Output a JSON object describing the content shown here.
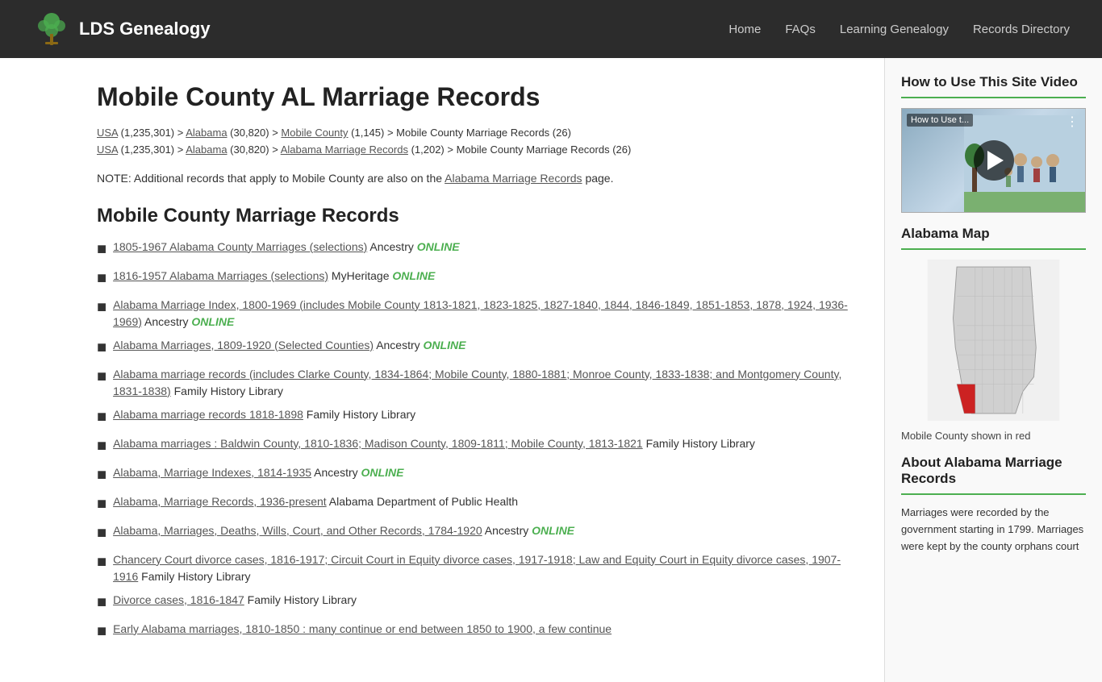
{
  "header": {
    "logo_text": "LDS Genealogy",
    "nav": [
      {
        "label": "Home",
        "id": "home"
      },
      {
        "label": "FAQs",
        "id": "faqs"
      },
      {
        "label": "Learning Genealogy",
        "id": "learning"
      },
      {
        "label": "Records Directory",
        "id": "records"
      }
    ]
  },
  "page": {
    "title": "Mobile County AL Marriage Records",
    "breadcrumbs": [
      {
        "line1_parts": [
          {
            "text": "USA",
            "link": true
          },
          {
            "text": " (1,235,301) > ",
            "link": false
          },
          {
            "text": "Alabama",
            "link": true
          },
          {
            "text": " (30,820) > ",
            "link": false
          },
          {
            "text": "Mobile County",
            "link": true
          },
          {
            "text": " (1,145) > Mobile County Marriage Records (26)",
            "link": false
          }
        ]
      },
      {
        "line2_parts": [
          {
            "text": "USA",
            "link": true
          },
          {
            "text": " (1,235,301) > ",
            "link": false
          },
          {
            "text": "Alabama",
            "link": true
          },
          {
            "text": " (30,820) > ",
            "link": false
          },
          {
            "text": "Alabama Marriage Records",
            "link": true
          },
          {
            "text": " (1,202) > Mobile County Marriage Records (26)",
            "link": false
          }
        ]
      }
    ],
    "note": "NOTE: Additional records that apply to Mobile County are also on the",
    "note_link": "Alabama Marriage Records",
    "note_end": " page.",
    "section_title": "Mobile County Marriage Records",
    "records": [
      {
        "link_text": "1805-1967 Alabama County Marriages (selections)",
        "source": " Ancestry ",
        "online": true
      },
      {
        "link_text": "1816-1957 Alabama Marriages (selections)",
        "source": " MyHeritage ",
        "online": true
      },
      {
        "link_text": "Alabama Marriage Index, 1800-1969 (includes Mobile County 1813-1821, 1823-1825, 1827-1840, 1844, 1846-1849, 1851-1853, 1878, 1924, 1936-1969)",
        "source": " Ancestry ",
        "online": true
      },
      {
        "link_text": "Alabama Marriages, 1809-1920 (Selected Counties)",
        "source": " Ancestry ",
        "online": true
      },
      {
        "link_text": "Alabama marriage records (includes Clarke County, 1834-1864; Mobile County, 1880-1881; Monroe County, 1833-1838; and Montgomery County, 1831-1838)",
        "source": " Family History Library",
        "online": false
      },
      {
        "link_text": "Alabama marriage records 1818-1898",
        "source": " Family History Library",
        "online": false
      },
      {
        "link_text": "Alabama marriages : Baldwin County, 1810-1836; Madison County, 1809-1811; Mobile County, 1813-1821",
        "source": " Family History Library",
        "online": false
      },
      {
        "link_text": "Alabama, Marriage Indexes, 1814-1935",
        "source": " Ancestry ",
        "online": true
      },
      {
        "link_text": "Alabama, Marriage Records, 1936-present",
        "source": " Alabama Department of Public Health",
        "online": false
      },
      {
        "link_text": "Alabama, Marriages, Deaths, Wills, Court, and Other Records, 1784-1920",
        "source": " Ancestry ",
        "online": true
      },
      {
        "link_text": "Chancery Court divorce cases, 1816-1917; Circuit Court in Equity divorce cases, 1917-1918; Law and Equity Court in Equity divorce cases, 1907- 1916",
        "source": " Family History Library",
        "online": false
      },
      {
        "link_text": "Divorce cases, 1816-1847",
        "source": " Family History Library",
        "online": false
      },
      {
        "link_text": "Early Alabama marriages, 1810-1850 : many continue or end between 1850 to 1900, a few continue",
        "source": "",
        "online": false
      }
    ]
  },
  "sidebar": {
    "how_to_use_title": "How to Use This Site Video",
    "video_label": "How to Use t...",
    "map_section_title": "Alabama Map",
    "map_caption": "Mobile County shown in red",
    "about_title": "About Alabama Marriage Records",
    "about_text": "Marriages were recorded by the government starting in 1799. Marriages were kept by the county orphans court"
  },
  "online_label": "ONLINE"
}
